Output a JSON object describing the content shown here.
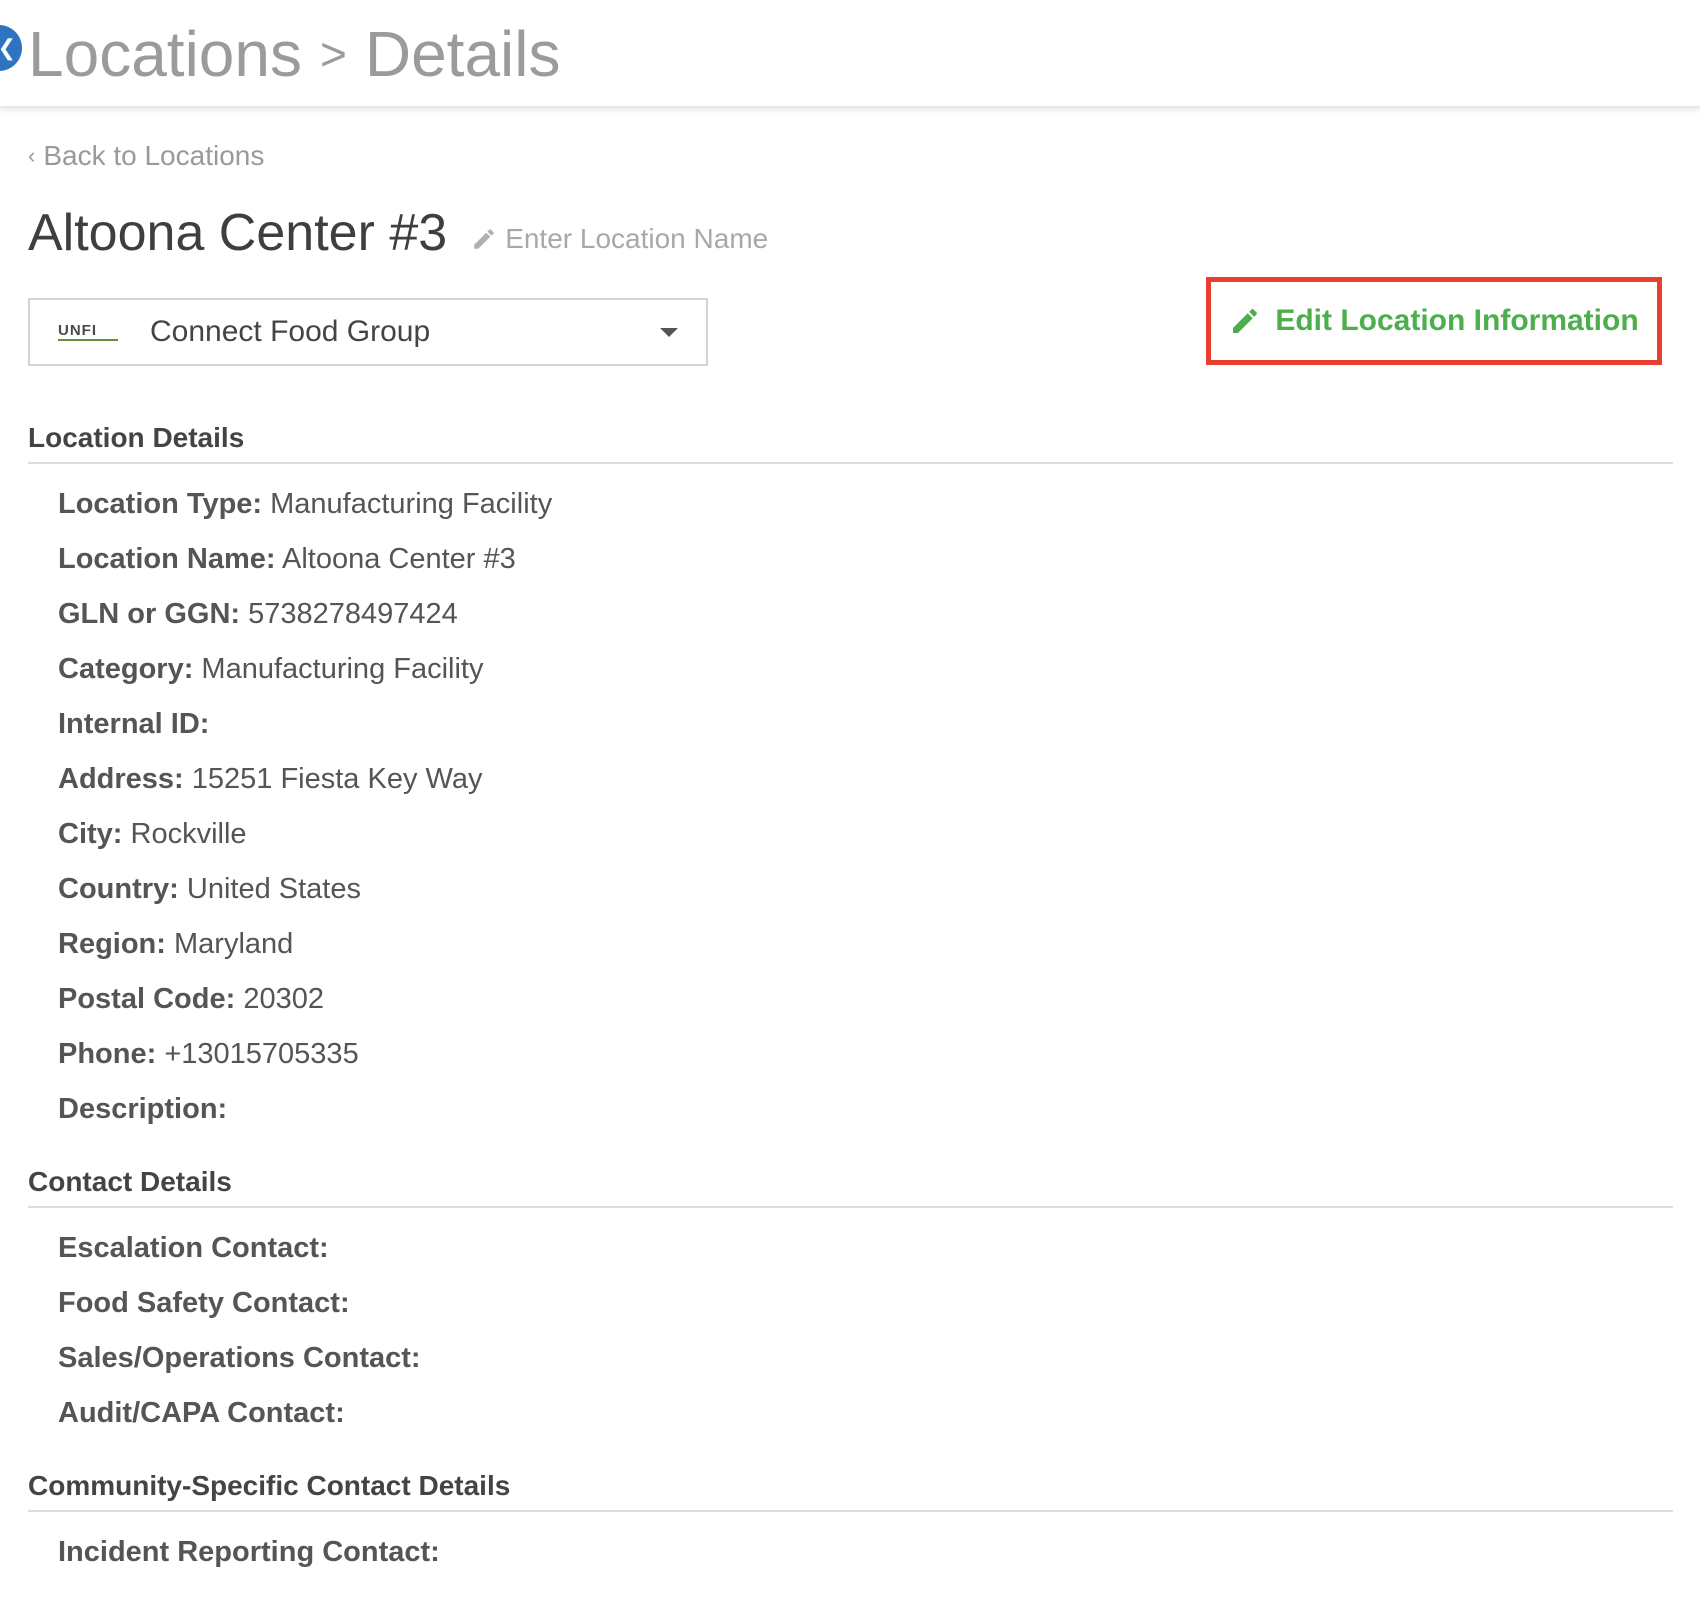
{
  "header": {
    "crumb_root": "Locations",
    "crumb_separator": ">",
    "crumb_current": "Details",
    "back_icon": "chevron-left-icon"
  },
  "back_link": "Back to Locations",
  "title": "Altoona Center #3",
  "name_hint": "Enter Location Name",
  "org_select": {
    "logo_text": "UNFI",
    "value": "Connect Food Group"
  },
  "edit_button": {
    "label": "Edit Location Information",
    "icon": "pencil-icon",
    "color": "#4cae4c",
    "highlight_color": "#e84030"
  },
  "location_details": {
    "heading": "Location Details",
    "fields": [
      {
        "label": "Location Type:",
        "value": "Manufacturing Facility"
      },
      {
        "label": "Location Name:",
        "value": "Altoona Center #3"
      },
      {
        "label": "GLN or GGN:",
        "value": "5738278497424"
      },
      {
        "label": "Category:",
        "value": "Manufacturing Facility"
      },
      {
        "label": "Internal ID:",
        "value": ""
      },
      {
        "label": "Address:",
        "value": "15251 Fiesta Key Way"
      },
      {
        "label": "City:",
        "value": "Rockville"
      },
      {
        "label": "Country:",
        "value": "United States"
      },
      {
        "label": "Region:",
        "value": "Maryland"
      },
      {
        "label": "Postal Code:",
        "value": "20302"
      },
      {
        "label": "Phone:",
        "value": "+13015705335"
      },
      {
        "label": "Description:",
        "value": ""
      }
    ]
  },
  "contact_details": {
    "heading": "Contact Details",
    "fields": [
      {
        "label": "Escalation Contact:",
        "value": ""
      },
      {
        "label": "Food Safety Contact:",
        "value": ""
      },
      {
        "label": "Sales/Operations Contact:",
        "value": ""
      },
      {
        "label": "Audit/CAPA Contact:",
        "value": ""
      }
    ]
  },
  "community_details": {
    "heading": "Community-Specific Contact Details",
    "fields": [
      {
        "label": "Incident Reporting Contact:",
        "value": ""
      }
    ]
  }
}
